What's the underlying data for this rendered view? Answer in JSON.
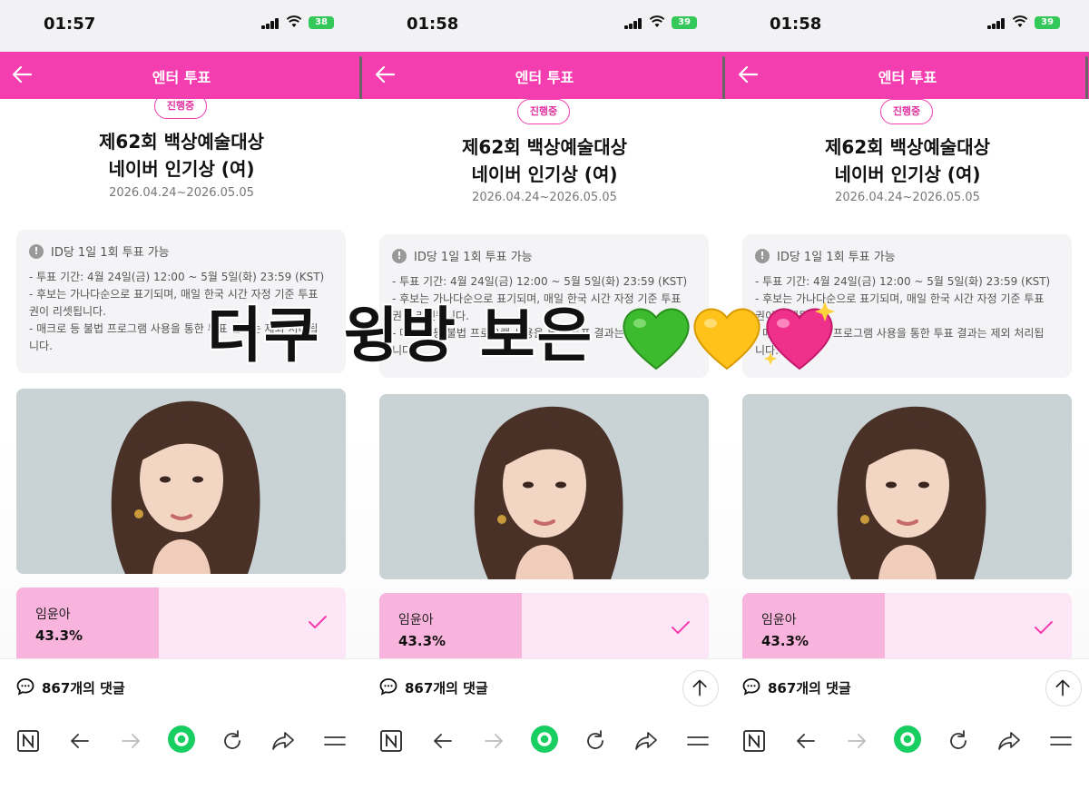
{
  "phones": [
    {
      "time": "01:57",
      "battery": "38"
    },
    {
      "time": "01:58",
      "battery": "39"
    },
    {
      "time": "01:58",
      "battery": "39"
    }
  ],
  "appbar": {
    "title": "엔터 투표"
  },
  "vote": {
    "status_badge": "진행중",
    "title_line1": "제62회 백상예술대상",
    "title_line2": "네이버 인기상 (여)",
    "period": "2026.04.24~2026.05.05"
  },
  "notice": {
    "heading": "ID당 1일 1회 투표 가능",
    "lines": [
      "- 투표 기간: 4월 24일(금) 12:00 ~ 5월 5일(화) 23:59 (KST)",
      "- 후보는 가나다순으로 표기되며, 매일 한국 시간 자정 기준 투표",
      "권이 리셋됩니다.",
      "- 매크로 등 불법 프로그램 사용을 통한 투표 결과는 제외 처리됩",
      "니다."
    ]
  },
  "candidate": {
    "name": "임윤아",
    "percent": "43.3%",
    "percent_value": 43.3
  },
  "comments": {
    "label": "867개의 댓글"
  },
  "overlay": {
    "text": "더쿠 윙방 보은"
  },
  "icons": {
    "back": "back-arrow-icon",
    "comment": "comment-bubble-icon",
    "up": "arrow-up-icon",
    "nav": [
      "naver-n-icon",
      "back-arrow-icon",
      "forward-arrow-icon",
      "green-home-icon",
      "reload-icon",
      "share-icon",
      "menu-icon"
    ],
    "hearts": [
      "green-heart-icon",
      "yellow-heart-icon",
      "sparkling-heart-icon"
    ]
  },
  "colors": {
    "brand": "#f43eb0",
    "vote_fill": "#f9b4dd",
    "vote_bg": "#fde6f5",
    "nav_green": "#19ce60"
  }
}
